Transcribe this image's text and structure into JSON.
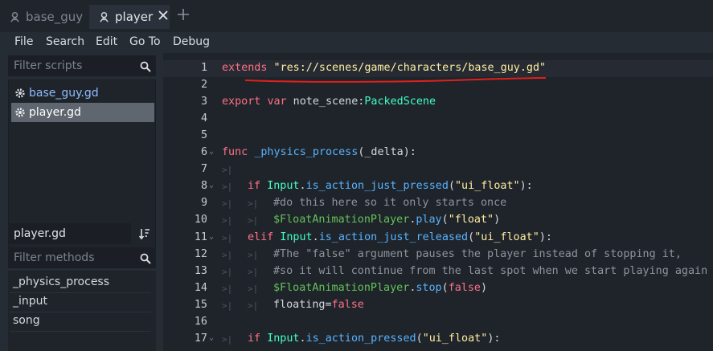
{
  "tabs": [
    {
      "label": "base_guy",
      "active": false
    },
    {
      "label": "player",
      "active": true
    }
  ],
  "menu": [
    "File",
    "Search",
    "Edit",
    "Go To",
    "Debug"
  ],
  "left": {
    "filter_scripts_placeholder": "Filter scripts",
    "scripts": [
      "base_guy.gd",
      "player.gd"
    ],
    "current_script": "player.gd",
    "filter_methods_placeholder": "Filter methods",
    "methods": [
      "_physics_process",
      "_input",
      "song"
    ]
  },
  "editor": {
    "lines": [
      {
        "n": "1",
        "parts": [
          [
            "kw",
            "extends"
          ],
          [
            "t",
            " "
          ],
          [
            "str",
            "\"res://scenes/game/characters/base_guy.gd\""
          ]
        ]
      },
      {
        "n": "2",
        "parts": []
      },
      {
        "n": "3",
        "parts": [
          [
            "kw",
            "export"
          ],
          [
            "t",
            " "
          ],
          [
            "kw",
            "var"
          ],
          [
            "t",
            " note_scene:"
          ],
          [
            "cls",
            "PackedScene"
          ]
        ]
      },
      {
        "n": "4",
        "parts": []
      },
      {
        "n": "5",
        "parts": []
      },
      {
        "n": "6",
        "fold": true,
        "parts": [
          [
            "kw",
            "func"
          ],
          [
            "t",
            " "
          ],
          [
            "fn",
            "_physics_process"
          ],
          [
            "t",
            "(_delta):"
          ]
        ]
      },
      {
        "n": "7",
        "tabs": 1,
        "parts": []
      },
      {
        "n": "8",
        "fold": true,
        "tabs": 1,
        "indent": 1,
        "parts": [
          [
            "kw",
            "if"
          ],
          [
            "t",
            " "
          ],
          [
            "cls",
            "Input"
          ],
          [
            "t",
            "."
          ],
          [
            "fn",
            "is_action_just_pressed"
          ],
          [
            "t",
            "("
          ],
          [
            "str",
            "\"ui_float\""
          ],
          [
            "t",
            "):"
          ]
        ]
      },
      {
        "n": "9",
        "tabs": 2,
        "indent": 2,
        "parts": [
          [
            "cmt",
            "#do this here so it only starts once"
          ]
        ]
      },
      {
        "n": "10",
        "tabs": 2,
        "indent": 2,
        "parts": [
          [
            "nodepath",
            "$FloatAnimationPlayer"
          ],
          [
            "t",
            "."
          ],
          [
            "fn",
            "play"
          ],
          [
            "t",
            "("
          ],
          [
            "str",
            "\"float\""
          ],
          [
            "t",
            ")"
          ]
        ]
      },
      {
        "n": "11",
        "fold": true,
        "tabs": 1,
        "indent": 1,
        "parts": [
          [
            "kw",
            "elif"
          ],
          [
            "t",
            " "
          ],
          [
            "cls",
            "Input"
          ],
          [
            "t",
            "."
          ],
          [
            "fn",
            "is_action_just_released"
          ],
          [
            "t",
            "("
          ],
          [
            "str",
            "\"ui_float\""
          ],
          [
            "t",
            "):"
          ]
        ]
      },
      {
        "n": "12",
        "tabs": 2,
        "indent": 2,
        "parts": [
          [
            "cmt",
            "#The \"false\" argument pauses the player instead of stopping it,"
          ]
        ]
      },
      {
        "n": "13",
        "tabs": 2,
        "indent": 2,
        "parts": [
          [
            "cmt",
            "#so it will continue from the last spot when we start playing again"
          ]
        ]
      },
      {
        "n": "14",
        "tabs": 2,
        "indent": 2,
        "parts": [
          [
            "nodepath",
            "$FloatAnimationPlayer"
          ],
          [
            "t",
            "."
          ],
          [
            "fn",
            "stop"
          ],
          [
            "t",
            "("
          ],
          [
            "kw",
            "false"
          ],
          [
            "t",
            ")"
          ]
        ]
      },
      {
        "n": "15",
        "tabs": 2,
        "indent": 2,
        "parts": [
          [
            "t",
            "floating="
          ],
          [
            "kw",
            "false"
          ]
        ]
      },
      {
        "n": "16",
        "parts": []
      },
      {
        "n": "17",
        "fold": true,
        "tabs": 1,
        "indent": 1,
        "parts": [
          [
            "kw",
            "if"
          ],
          [
            "t",
            " "
          ],
          [
            "cls",
            "Input"
          ],
          [
            "t",
            "."
          ],
          [
            "fn",
            "is_action_pressed"
          ],
          [
            "t",
            "("
          ],
          [
            "str",
            "\"ui_float\""
          ],
          [
            "t",
            "):"
          ]
        ]
      }
    ]
  },
  "colors": {
    "keyword": "#ff7085",
    "string": "#ffeda1",
    "class": "#42ffc2",
    "function": "#57b3ff",
    "comment": "#8e949d",
    "annotation_underline": "#e0201b"
  },
  "icons": {
    "tab": "script-robot-icon",
    "close": "close-icon",
    "add": "plus-icon",
    "search": "search-icon",
    "script": "gear-icon",
    "sort": "sort-icon"
  }
}
